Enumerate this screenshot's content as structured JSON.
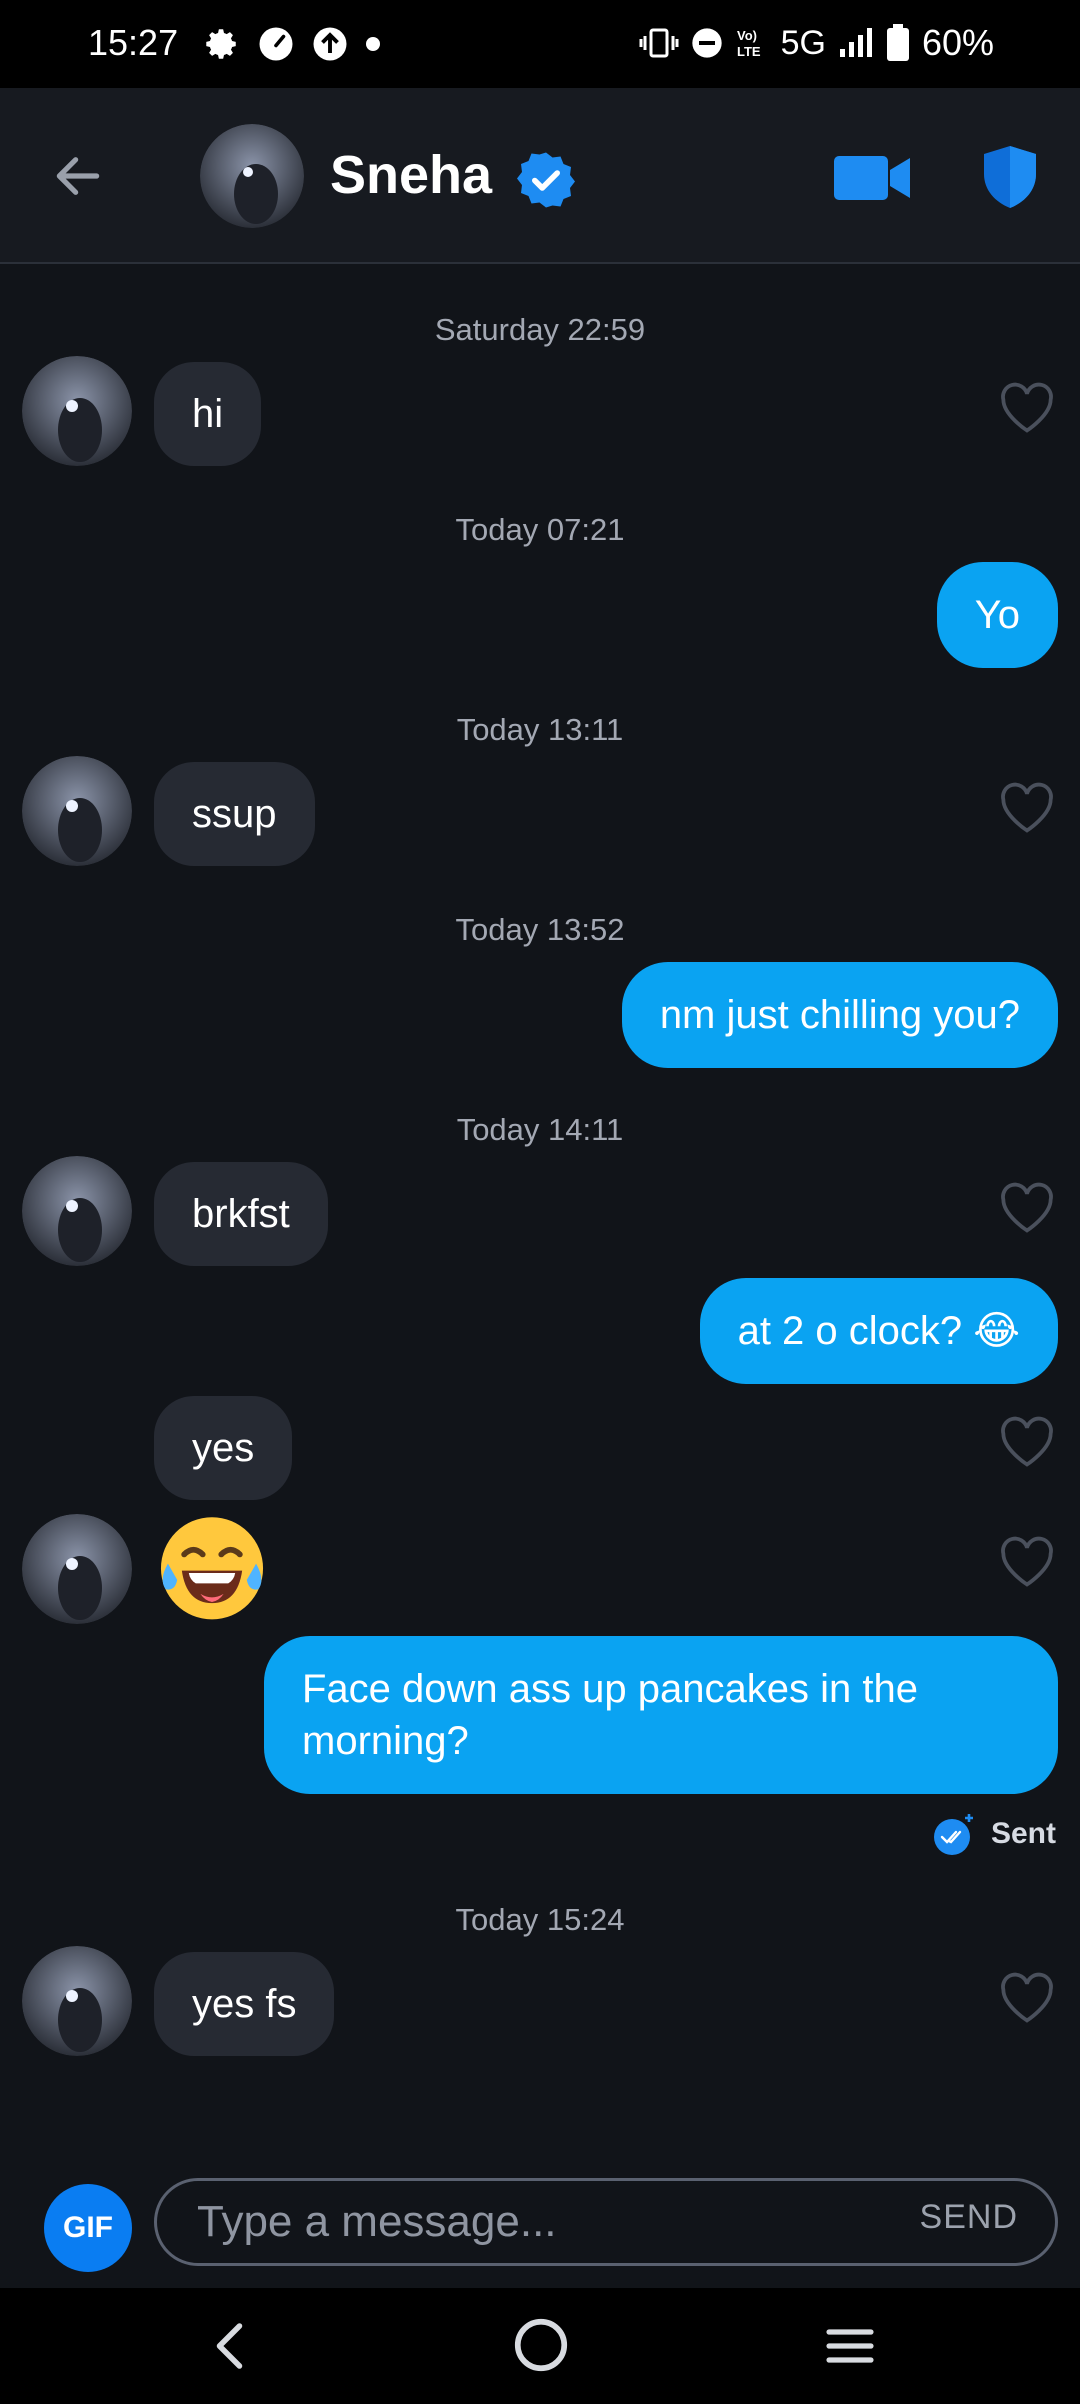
{
  "status_bar": {
    "time": "15:27",
    "network": "5G",
    "battery": "60%"
  },
  "header": {
    "contact_name": "Sneha"
  },
  "messages": [
    {
      "timestamp": "Saturday 22:59",
      "text": "hi"
    },
    {
      "timestamp": "Today 07:21",
      "text": "Yo"
    },
    {
      "timestamp": "Today 13:11",
      "text": "ssup"
    },
    {
      "timestamp": "Today 13:52",
      "text": "nm just chilling you?"
    },
    {
      "timestamp": "Today 14:11",
      "text": "brkfst"
    },
    {
      "text": "at 2 o clock? 😂"
    },
    {
      "text": "yes"
    },
    {
      "text": "😂"
    },
    {
      "text": "Face down ass up pancakes in the morning?"
    },
    {
      "timestamp": "Today 15:24",
      "text": "yes fs"
    }
  ],
  "sent_status": "Sent",
  "composer": {
    "gif_label": "GIF",
    "placeholder": "Type a message...",
    "send_label": "SEND"
  },
  "colors": {
    "accent": "#0aa3f2",
    "incoming_bubble": "#262a33",
    "background": "#111419"
  }
}
